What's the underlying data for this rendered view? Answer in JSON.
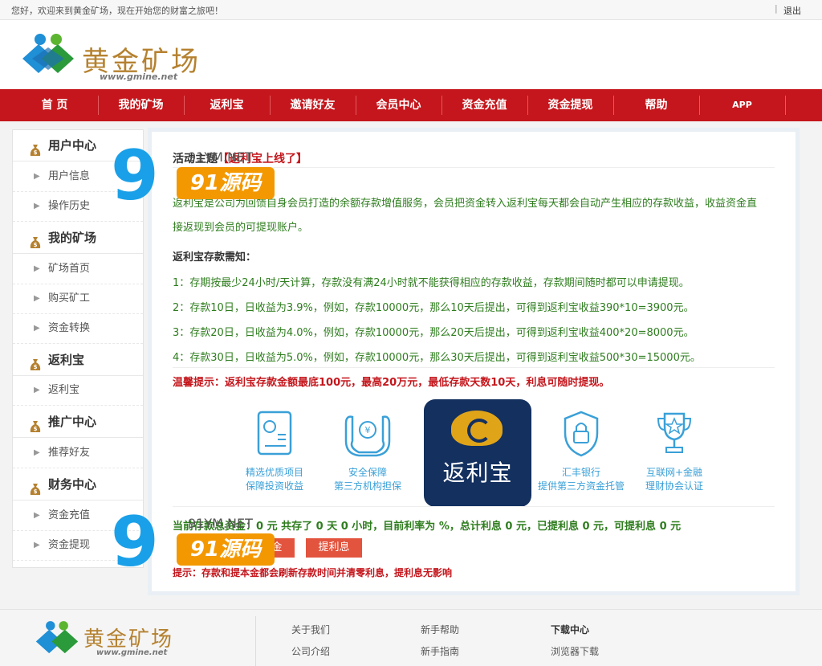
{
  "topbar": {
    "welcome": "您好，欢迎来到黄金矿场，现在开始您的财富之旅吧！",
    "separator": "|",
    "logout": "退出"
  },
  "header": {
    "logo_text": "黄金矿场",
    "logo_sub": "www.gmine.net"
  },
  "nav": {
    "items": [
      "首 页",
      "我的矿场",
      "返利宝",
      "邀请好友",
      "会员中心",
      "资金充值",
      "资金提现",
      "帮助",
      "APP"
    ]
  },
  "sidebar": {
    "sections": [
      {
        "title": "用户中心",
        "links": [
          "用户信息",
          "操作历史"
        ]
      },
      {
        "title": "我的矿场",
        "links": [
          "矿场首页",
          "购买矿工",
          "资金转换"
        ]
      },
      {
        "title": "返利宝",
        "links": [
          "返利宝"
        ]
      },
      {
        "title": "推广中心",
        "links": [
          "推荐好友"
        ]
      },
      {
        "title": "财务中心",
        "links": [
          "资金充值",
          "资金提现"
        ]
      }
    ]
  },
  "main": {
    "heading_prefix": "活动主题",
    "heading_red": "【返利宝上线了】",
    "intro": "返利宝是公司为回馈自身会员打造的余额存款增值服务，会员把资金转入返利宝每天都会自动产生相应的存款收益，收益资金直接返现到会员的可提现账户。",
    "rules_title": "返利宝存款需知：",
    "rules": [
      "1：存期按最少24小时/天计算，存款没有满24小时就不能获得相应的存款收益，存款期间随时都可以申请提现。",
      "2：存款10日，日收益为3.9%，例如，存款10000元，那么10天后提出，可得到返利宝收益390*10=3900元。",
      "3：存款20日，日收益为4.0%，例如，存款10000元，那么20天后提出，可得到返利宝收益400*20=8000元。",
      "4：存款30日，日收益为5.0%，例如，存款10000元，那么30天后提出，可得到返利宝收益500*30=15000元。"
    ],
    "warning": "温馨提示：返利宝存款金额最底100元，最高20万元，最低存款天数10天，利息可随时提现。",
    "features": [
      {
        "line1": "精选优质项目",
        "line2": "保障投资收益",
        "icon": "certificate-icon"
      },
      {
        "line1": "安全保障",
        "line2": "第三方机构担保",
        "icon": "hands-money-icon"
      },
      {
        "line1": "汇丰银行",
        "line2": "提供第三方资金托管",
        "icon": "lock-shield-icon"
      },
      {
        "line1": "互联网+金融",
        "line2": "理财协会认证",
        "icon": "trophy-icon"
      }
    ],
    "badge_label": "返利宝",
    "stats": "当前存款总资金：0 元 共存了 0 天 0 小时，目前利率为 %，总计利息 0 元，已提利息 0 元，可提利息 0 元",
    "btn_withdraw_principal": "提本金",
    "btn_withdraw_interest": "提利息",
    "tip": "提示：存款和提本金都会刷新存款时间并清零利息，提利息无影响"
  },
  "footer": {
    "logo_text": "黄金矿场",
    "logo_sub": "www.gmine.net",
    "col1": [
      "关于我们",
      "公司介绍"
    ],
    "col2": [
      "新手帮助",
      "新手指南"
    ],
    "col3_head": "下载中心",
    "col3": [
      "浏览器下载"
    ]
  },
  "watermark": {
    "url": "91YM.NET",
    "brand": "91源码"
  },
  "colors": {
    "nav_red": "#c4161c",
    "gold": "#b5812f",
    "green_text": "#2e7d1e",
    "button": "#e2543e",
    "feature_blue": "#3aa0d8"
  }
}
